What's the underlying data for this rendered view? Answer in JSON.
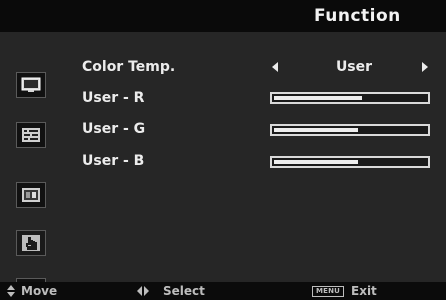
{
  "header": {
    "title": "Function"
  },
  "sidebar": {
    "icons": [
      "picture-icon",
      "image-settings-icon",
      "color-icon",
      "function-hand-icon",
      "information-icon"
    ]
  },
  "settings": {
    "color_temp": {
      "label": "Color Temp.",
      "value": "User"
    },
    "user_r": {
      "label": "User - R",
      "level_fraction": 0.58
    },
    "user_g": {
      "label": "User - G",
      "level_fraction": 0.55
    },
    "user_b": {
      "label": "User - B",
      "level_fraction": 0.55
    }
  },
  "footer": {
    "move_label": "Move",
    "select_label": "Select",
    "menu_key": "MENU",
    "exit_label": "Exit"
  },
  "colors": {
    "background": "#080808",
    "panel": "#262626",
    "text": "#ececec"
  }
}
